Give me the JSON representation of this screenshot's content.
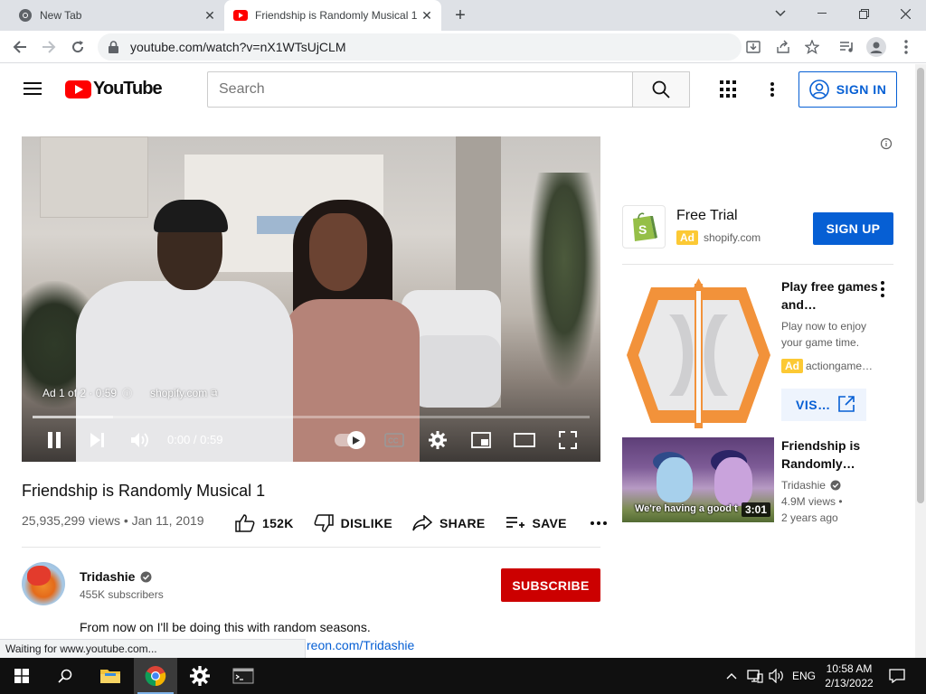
{
  "browser": {
    "tabs": [
      {
        "title": "New Tab",
        "icon": "chrome-icon"
      },
      {
        "title": "Friendship is Randomly Musical 1",
        "icon": "youtube-icon",
        "active": true
      }
    ],
    "url": "youtube.com/watch?v=nX1WTsUjCLM",
    "status_text": "Waiting for www.youtube.com..."
  },
  "header": {
    "logo_text": "YouTube",
    "search_placeholder": "Search",
    "sign_in_label": "SIGN IN"
  },
  "player": {
    "ad_position": "Ad 1 of 2 · 0:59",
    "ad_domain": "shopify.com",
    "time_display": "0:00 / 0:59",
    "progress_fraction": 0.0,
    "buffer_fraction": 0.145,
    "accent_color": "#ffcc00"
  },
  "video": {
    "title": "Friendship is Randomly Musical 1",
    "meta": "25,935,299 views • Jan 11, 2019",
    "likes": "152K",
    "dislike_label": "DISLIKE",
    "share_label": "SHARE",
    "save_label": "SAVE"
  },
  "channel": {
    "name": "Tridashie",
    "subscribers": "455K subscribers",
    "subscribe_label": "SUBSCRIBE",
    "description_line1": "From now on I'll be doing this with random seasons.",
    "description_link": "reon.com/Tridashie"
  },
  "sidebar": {
    "companion_ad": {
      "title": "Free Trial",
      "badge": "Ad",
      "domain": "shopify.com",
      "cta": "SIGN UP"
    },
    "game_ad": {
      "title": "Play free games and…",
      "description": "Play now to enjoy your game time.",
      "badge": "Ad",
      "domain": "actiongame…",
      "cta": "VIS…"
    },
    "recommended": [
      {
        "title": "Friendship is Randomly…",
        "channel": "Tridashie",
        "views": "4.9M views •",
        "age": "2 years ago",
        "duration": "3:01",
        "thumb_caption": "We're having a good t"
      }
    ]
  },
  "taskbar": {
    "language": "ENG",
    "time": "10:58 AM",
    "date": "2/13/2022"
  },
  "colors": {
    "brand_red": "#ff0000",
    "link_blue": "#065fd4",
    "subscribe_red": "#cc0000",
    "ad_badge": "#fcc934"
  }
}
